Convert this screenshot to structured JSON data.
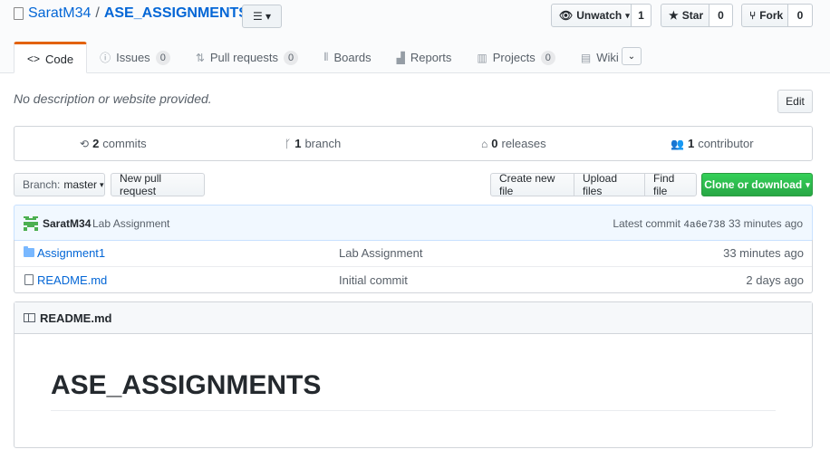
{
  "repo": {
    "owner": "SaratM34",
    "name": "ASE_ASSIGNMENTS",
    "separator": "/",
    "menu_icon": "list-icon"
  },
  "actions": {
    "watch": {
      "label": "Unwatch",
      "count": "1"
    },
    "star": {
      "label": "Star",
      "count": "0"
    },
    "fork": {
      "label": "Fork",
      "count": "0"
    }
  },
  "tabs": [
    {
      "label": "Code",
      "icon": "code-icon",
      "counter": "",
      "selected": true
    },
    {
      "label": "Issues",
      "icon": "issue-icon",
      "counter": "0"
    },
    {
      "label": "Pull requests",
      "icon": "pull-request-icon",
      "counter": "0"
    },
    {
      "label": "Boards",
      "icon": "boards-icon",
      "counter": ""
    },
    {
      "label": "Reports",
      "icon": "graph-icon",
      "counter": ""
    },
    {
      "label": "Projects",
      "icon": "project-icon",
      "counter": "0"
    },
    {
      "label": "Wiki",
      "icon": "book-icon",
      "counter": ""
    }
  ],
  "description": "No description or website provided.",
  "edit_label": "Edit",
  "summary": {
    "commits": {
      "num": "2",
      "label": "commits"
    },
    "branches": {
      "num": "1",
      "label": "branch"
    },
    "releases": {
      "num": "0",
      "label": "releases"
    },
    "contributors": {
      "num": "1",
      "label": "contributor"
    }
  },
  "file_nav": {
    "branch_prefix": "Branch:",
    "branch_name": "master",
    "new_pr": "New pull request",
    "create_file": "Create new file",
    "upload_files": "Upload files",
    "find_file": "Find file",
    "clone": "Clone or download"
  },
  "commit": {
    "author": "SaratM34",
    "message": "Lab Assignment",
    "latest_label": "Latest commit",
    "sha": "4a6e738",
    "age": "33 minutes ago"
  },
  "files": [
    {
      "name": "Assignment1",
      "type": "folder",
      "message": "Lab Assignment",
      "age": "33 minutes ago"
    },
    {
      "name": "README.md",
      "type": "file",
      "message": "Initial commit",
      "age": "2 days ago"
    }
  ],
  "readme": {
    "filename": "README.md",
    "heading": "ASE_ASSIGNMENTS"
  },
  "colors": {
    "link": "#0366d6",
    "tab_accent": "#e36209",
    "clone_green": "#28a745",
    "commit_bg": "#f1f8ff"
  }
}
